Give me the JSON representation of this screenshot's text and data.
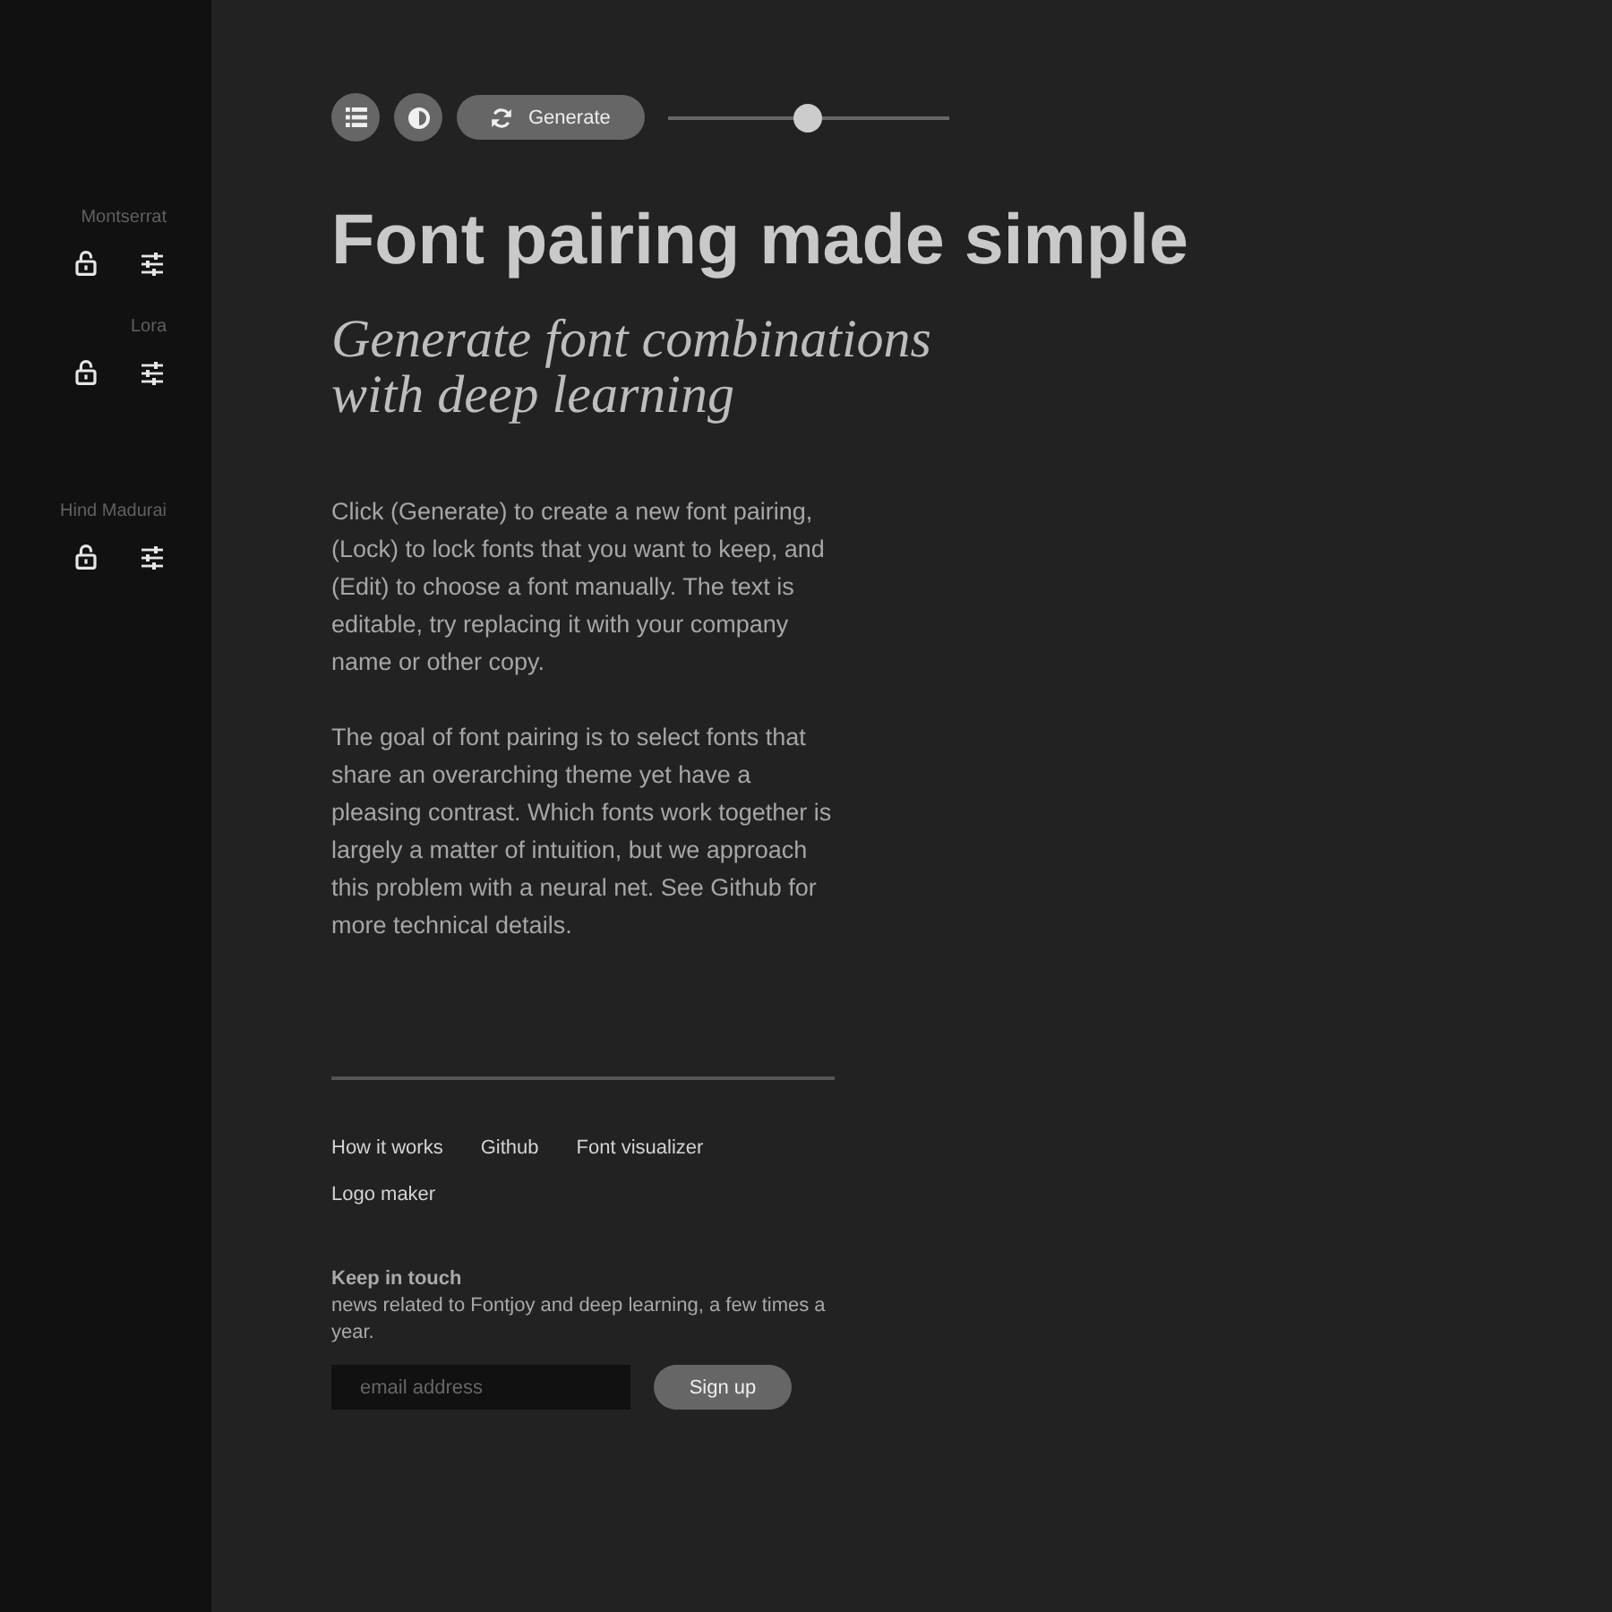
{
  "fonts": [
    {
      "name": "Montserrat",
      "kind": "heading",
      "locked": false
    },
    {
      "name": "Lora",
      "kind": "subheading",
      "locked": false
    },
    {
      "name": "Hind Madurai",
      "kind": "body",
      "locked": false
    }
  ],
  "toolbar": {
    "generate": "Generate",
    "slider": {
      "level": 0.5
    }
  },
  "heading": "Font pairing made simple",
  "subheading": "Generate font combinations with deep learning",
  "paragraphs": [
    "Click (Generate) to create a new font pairing, (Lock) to lock fonts that you want to keep, and (Edit) to choose a font manually. The text is editable, try replacing it with your company name or other copy.",
    "The goal of font pairing is to select fonts that share an overarching theme yet have a pleasing contrast. Which fonts work together is largely a matter of intuition, but we approach this problem with a neural net. See Github for more technical details."
  ],
  "links": [
    "How it works",
    "Github",
    "Font visualizer",
    "Logo maker"
  ],
  "newsletter": {
    "title": "Keep in touch",
    "text": "news related to Fontjoy and deep learning, a few times a year.",
    "email": {
      "placeholder": "email address"
    },
    "button": "Sign up"
  }
}
